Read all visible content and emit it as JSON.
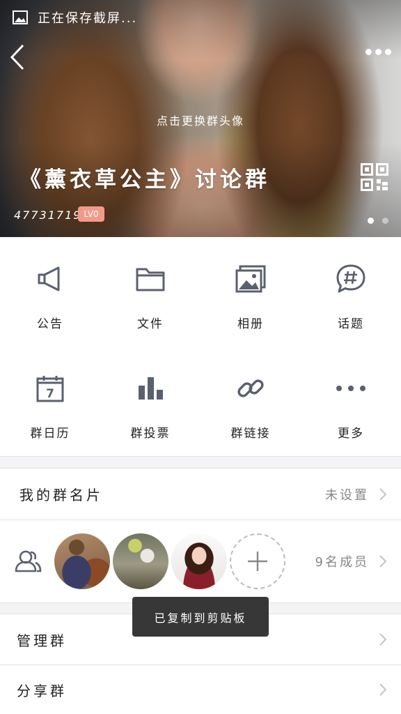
{
  "status_bar": {
    "text": "正在保存截屏..."
  },
  "header": {
    "change_avatar_hint": "点击更换群头像",
    "group_name": "《薰衣草公主》讨论群",
    "group_id": "477317191",
    "level": "LV0"
  },
  "features": [
    {
      "label": "公告",
      "icon": "megaphone-icon"
    },
    {
      "label": "文件",
      "icon": "folder-icon"
    },
    {
      "label": "相册",
      "icon": "album-icon"
    },
    {
      "label": "话题",
      "icon": "topic-icon"
    },
    {
      "label": "群日历",
      "icon": "calendar-icon"
    },
    {
      "label": "群投票",
      "icon": "vote-icon"
    },
    {
      "label": "群链接",
      "icon": "link-icon"
    },
    {
      "label": "更多",
      "icon": "more-dots-icon"
    }
  ],
  "calendar_day": "7",
  "group_card": {
    "label": "我的群名片",
    "value": "未设置"
  },
  "members": {
    "count_label": "9名成员"
  },
  "manage": {
    "label": "管理群"
  },
  "share": {
    "label": "分享群"
  },
  "toast": {
    "text": "已复制到剪贴板"
  },
  "colors": {
    "icon": "#5b6070",
    "badge": "#f29a8a",
    "background": "#f4f4f6"
  }
}
